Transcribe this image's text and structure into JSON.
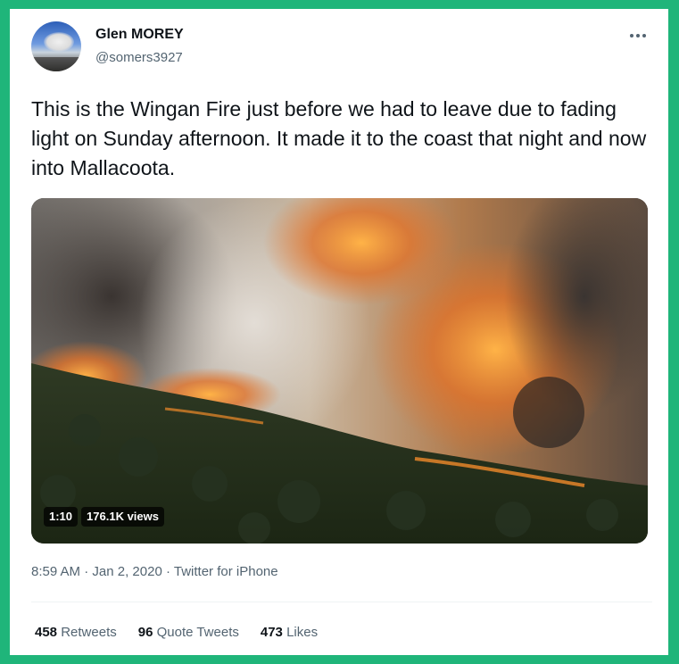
{
  "author": {
    "name": "Glen MOREY",
    "handle": "@somers3927"
  },
  "tweet": {
    "text": "This is the Wingan Fire just before we had to leave due to fading light on Sunday afternoon. It made it to the coast that night and now into Mallacoota."
  },
  "video": {
    "duration": "1:10",
    "views": "176.1K views"
  },
  "meta": {
    "time": "8:59 AM",
    "sep1": "·",
    "date": "Jan 2, 2020",
    "sep2": "·",
    "source": "Twitter for iPhone"
  },
  "stats": {
    "retweets_count": "458",
    "retweets_label": "Retweets",
    "quotes_count": "96",
    "quotes_label": "Quote Tweets",
    "likes_count": "473",
    "likes_label": "Likes"
  },
  "colors": {
    "frame": "#1fb57a",
    "text_primary": "#0f1419",
    "text_secondary": "#536471"
  }
}
